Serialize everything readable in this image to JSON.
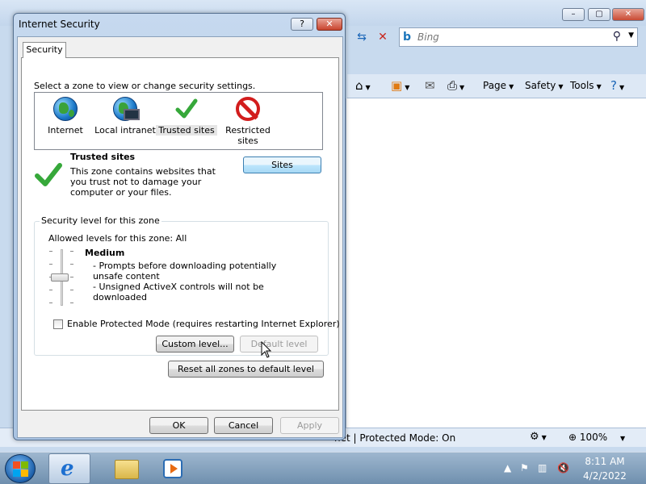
{
  "browser": {
    "search_placeholder": "Bing",
    "command_bar": {
      "page_label": "Page",
      "safety_label": "Safety",
      "tools_label": "Tools"
    },
    "status_bar": {
      "zone_text": "net | Protected Mode: On",
      "zoom_text": "100%"
    }
  },
  "dialog": {
    "title": "Internet Security",
    "help_label": "?",
    "close_label": "✕",
    "tab_label": "Security",
    "zone_prompt": "Select a zone to view or change security settings.",
    "zones": [
      {
        "label": "Internet",
        "icon": "globe-icon"
      },
      {
        "label": "Local intranet",
        "icon": "local-intranet-icon"
      },
      {
        "label": "Trusted sites",
        "icon": "checkmark-icon",
        "selected": true
      },
      {
        "label": "Restricted sites",
        "icon": "restricted-icon"
      }
    ],
    "selected_zone": {
      "name": "Trusted sites",
      "description": "This zone contains websites that you trust not to damage your computer or your files.",
      "sites_button": "Sites"
    },
    "security_level": {
      "legend": "Security level for this zone",
      "allowed": "Allowed levels for this zone: All",
      "level_name": "Medium",
      "level_desc_1": "- Prompts before downloading potentially unsafe content",
      "level_desc_2": "- Unsigned ActiveX controls will not be downloaded",
      "protected_mode_label": "Enable Protected Mode (requires restarting Internet Explorer)",
      "protected_mode_checked": false,
      "custom_level_button": "Custom level...",
      "default_level_button": "Default level"
    },
    "reset_button": "Reset all zones to default level",
    "ok_button": "OK",
    "cancel_button": "Cancel",
    "apply_button": "Apply"
  },
  "taskbar": {
    "clock_time": "8:11 AM",
    "clock_date": "4/2/2022"
  },
  "colors": {
    "accent": "#3c7fb1",
    "check_green": "#36a83a",
    "restricted_red": "#d21d1d"
  }
}
